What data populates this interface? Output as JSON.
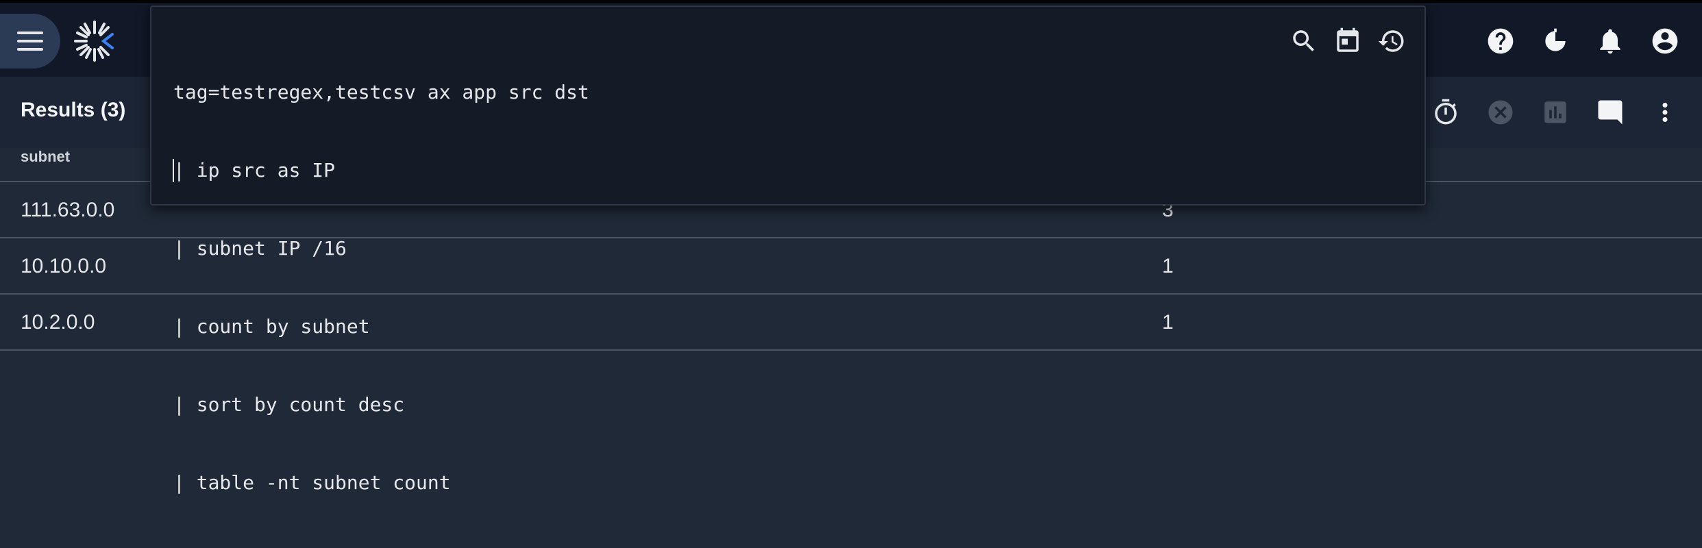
{
  "colors": {
    "background": "#1f2937",
    "topbar": "#111827",
    "popup": "#141b26",
    "accent": "#60a5fa"
  },
  "topbar": {
    "icons": [
      "menu-icon",
      "logo-icon",
      "help-icon",
      "timer-icon",
      "bell-icon",
      "account-icon"
    ]
  },
  "query": {
    "lines": [
      "tag=testregex,testcsv ax app src dst",
      "| ip src as IP",
      "| subnet IP /16",
      "| count by subnet",
      "| sort by count desc",
      "| table -nt subnet count"
    ],
    "icons": [
      "search-icon",
      "calendar-icon",
      "history-icon"
    ]
  },
  "results": {
    "title": "Results (3)",
    "icons": [
      "stopwatch-icon",
      "cancel-icon",
      "chart-icon",
      "comment-icon",
      "more-vert-icon"
    ]
  },
  "table": {
    "columns": [
      "subnet"
    ],
    "rows": [
      {
        "subnet": "111.63.0.0",
        "count": "3"
      },
      {
        "subnet": "10.10.0.0",
        "count": "1"
      },
      {
        "subnet": "10.2.0.0",
        "count": "1"
      }
    ]
  }
}
